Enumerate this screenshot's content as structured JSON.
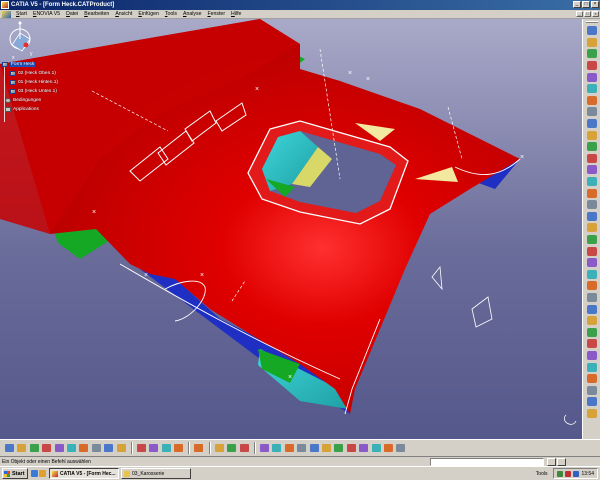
{
  "window": {
    "title": "CATIA V5 - [Form Heck.CATProduct]",
    "controls": [
      "_",
      "□",
      "×"
    ]
  },
  "menu": {
    "items": [
      "Start",
      "ENOVIA V5",
      "Datei",
      "Bearbeiten",
      "Ansicht",
      "Einfügen",
      "Tools",
      "Analyse",
      "Fenster",
      "Hilfe"
    ],
    "controls": [
      "_",
      "□",
      "×"
    ]
  },
  "tree": {
    "root": "Form Heck",
    "children": [
      "02 (Heck Oben.1)",
      "01 (Heck Hinten.1)",
      "03 (Heck Unten.1)"
    ],
    "aux": [
      "Bedingungen",
      "Applications"
    ]
  },
  "toolbar_right": {
    "icons": [
      "sketcher-icon",
      "part-design-icon",
      "wireframe-icon",
      "surface-icon",
      "extrude-icon",
      "revolve-icon",
      "sphere-icon",
      "cylinder-icon",
      "offset-icon",
      "sweep-icon",
      "fill-icon",
      "loft-icon",
      "blend-icon",
      "join-icon",
      "healing-icon",
      "untrim-icon",
      "split-icon",
      "trim-icon",
      "boundary-icon",
      "extract-icon",
      "fillet-icon",
      "translate-icon",
      "rotate-icon",
      "symmetry-icon",
      "scaling-icon",
      "affinity-icon",
      "extrapolate-icon",
      "invert-icon",
      "near-icon",
      "analysis-icon",
      "draft-analysis-icon",
      "curvature-icon",
      "connect-icon",
      "cut-icon"
    ]
  },
  "toolbar_bottom": {
    "groups": [
      [
        "new-icon",
        "open-icon",
        "save-icon",
        "print-icon",
        "cut-icon",
        "copy-icon",
        "paste-icon",
        "undo-icon",
        "redo-icon",
        "whats-this-icon"
      ],
      [
        "update-icon",
        "catalog-icon",
        "formula-icon",
        "knowledge-icon"
      ],
      [
        "swap-icon"
      ],
      [
        "measure-icon",
        "axis-icon",
        "material-icon"
      ],
      [
        "fly-icon",
        "fit-all-icon",
        "pan-icon",
        "rotate-view-icon",
        "zoom-in-icon",
        "zoom-out-icon",
        "normal-view-icon",
        "iso-view-icon",
        "shading-icon",
        "hide-show-icon",
        "swap-visible-icon",
        "layer-icon"
      ]
    ]
  },
  "statusbar": {
    "message": "Ein Objekt oder einen Befehl auswählen",
    "command_value": ""
  },
  "taskbar": {
    "start": "Start",
    "tasks": [
      {
        "label": "CATIA V5 - [Form Hec...",
        "active": true
      },
      {
        "label": "03_Karosserie",
        "active": false
      }
    ],
    "tray_tools": "Tools",
    "clock": "13:54"
  }
}
